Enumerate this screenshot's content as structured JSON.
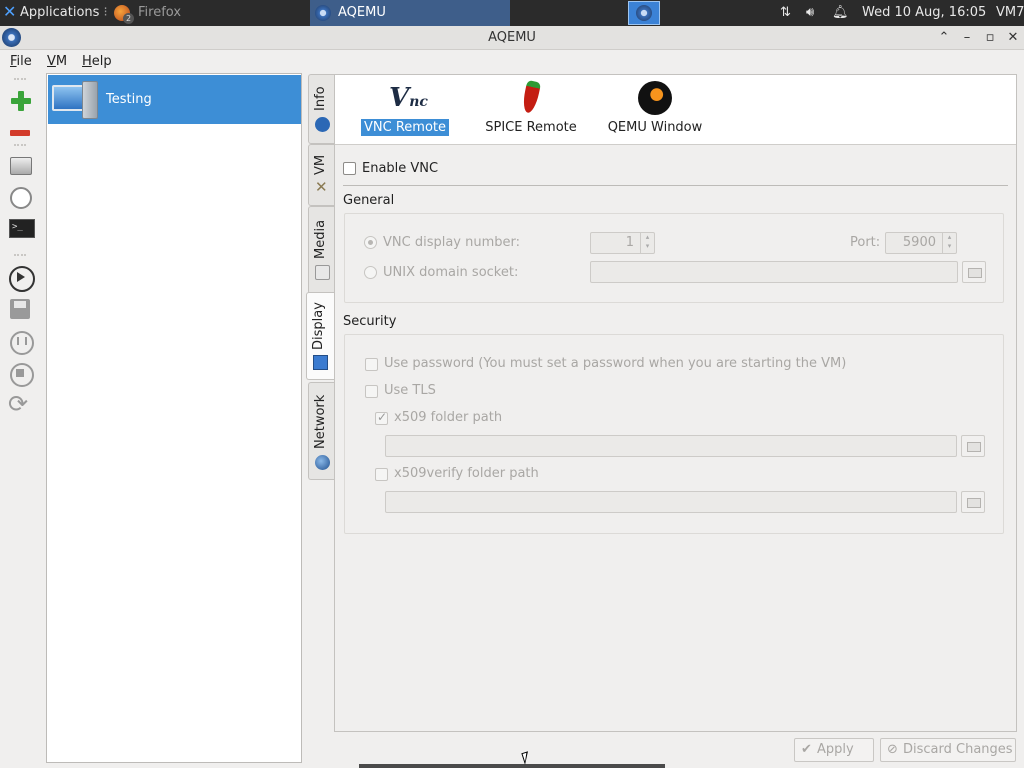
{
  "panel": {
    "applications": "Applications",
    "task_firefox": "Firefox",
    "task_firefox_count": "2",
    "task_aqemu": "AQEMU",
    "clock": "Wed 10 Aug, 16:05",
    "host": "VM7"
  },
  "window": {
    "title": "AQEMU",
    "buttons": [
      "^",
      "_",
      "□",
      "×"
    ]
  },
  "menu": [
    "File",
    "VM",
    "Help"
  ],
  "toolbar": [
    "add-vm",
    "remove-vm",
    "disk",
    "clock",
    "terminal",
    "play",
    "save",
    "pause",
    "stop",
    "reset"
  ],
  "vm_list": [
    {
      "name": "Testing",
      "selected": true
    }
  ],
  "tabs": [
    {
      "label": "Info",
      "icon": "info-icon"
    },
    {
      "label": "VM",
      "icon": "tools-icon"
    },
    {
      "label": "Media",
      "icon": "media-icon"
    },
    {
      "label": "Display",
      "icon": "display-icon",
      "active": true
    },
    {
      "label": "Network",
      "icon": "network-icon"
    }
  ],
  "display_modes": [
    {
      "label": "VNC Remote",
      "icon": "vnc-icon",
      "selected": true
    },
    {
      "label": "SPICE Remote",
      "icon": "spice-icon"
    },
    {
      "label": "QEMU Window",
      "icon": "qemu-icon"
    }
  ],
  "enable_vnc": {
    "label": "Enable VNC",
    "checked": false
  },
  "general": {
    "title": "General",
    "vnc_display_number_label": "VNC display number:",
    "vnc_display_number_value": "1",
    "port_label": "Port:",
    "port_value": "5900",
    "unix_socket_label": "UNIX domain socket:",
    "unix_socket_value": ""
  },
  "security": {
    "title": "Security",
    "use_password_label": "Use password (You must set a password when you are starting the VM)",
    "use_tls_label": "Use TLS",
    "x509_folder_label": "x509 folder path",
    "x509_folder_checked": true,
    "x509_folder_value": "",
    "x509verify_folder_label": "x509verify folder path",
    "x509verify_folder_checked": false,
    "x509verify_folder_value": ""
  },
  "actions": {
    "apply": "Apply",
    "discard": "Discard Changes"
  },
  "colors": {
    "selection": "#3d8ed6",
    "panel_bg": "#2b2b2b",
    "active_task": "#3e5e8a"
  }
}
